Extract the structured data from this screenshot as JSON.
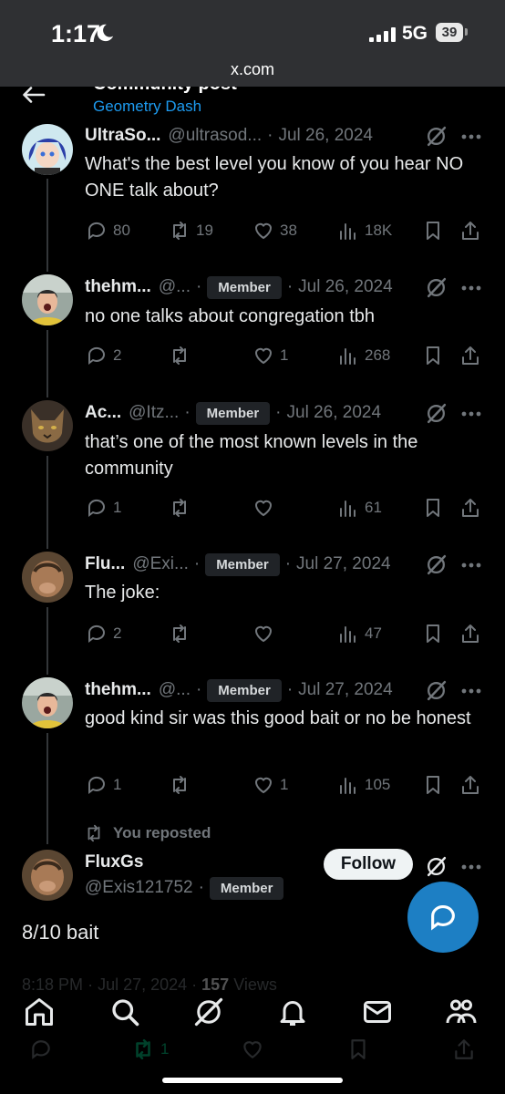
{
  "status_bar": {
    "time": "1:17",
    "network": "5G",
    "battery": "39"
  },
  "browser": {
    "url": "x.com"
  },
  "header": {
    "title": "Community post",
    "community": "Geometry Dash"
  },
  "posts": [
    {
      "name": "UltraSo...",
      "handle": "@ultrasod...",
      "badge": "",
      "date": "Jul 26, 2024",
      "text": "What's the best level you know of you hear NO ONE talk about?",
      "replies": "80",
      "reposts": "19",
      "likes": "38",
      "views": "18K"
    },
    {
      "name": "thehm...",
      "handle": "@...",
      "badge": "Member",
      "date": "Jul 26, 2024",
      "text": "no one talks about congregation tbh",
      "replies": "2",
      "reposts": "",
      "likes": "1",
      "views": "268"
    },
    {
      "name": "Ac...",
      "handle": "@Itz...",
      "badge": "Member",
      "date": "Jul 26, 2024",
      "text": "that’s one of the most known levels in the community",
      "replies": "1",
      "reposts": "",
      "likes": "",
      "views": "61"
    },
    {
      "name": "Flu...",
      "handle": "@Exi...",
      "badge": "Member",
      "date": "Jul 27, 2024",
      "text": "The joke:",
      "replies": "2",
      "reposts": "",
      "likes": "",
      "views": "47"
    },
    {
      "name": "thehm...",
      "handle": "@...",
      "badge": "Member",
      "date": "Jul 27, 2024",
      "text": "good kind sir was this good bait or no be honest",
      "replies": "1",
      "reposts": "",
      "likes": "1",
      "views": "105"
    }
  ],
  "repost_indicator": "You reposted",
  "main_post": {
    "name": "FluxGs",
    "handle": "@Exis121752",
    "badge": "Member",
    "follow_label": "Follow",
    "text": "8/10 bait",
    "time": "8:18 PM",
    "date": "Jul 27, 2024",
    "views_count": "157",
    "views_label": "Views",
    "reposts": "1"
  },
  "colors": {
    "accent": "#1d9bf0",
    "background": "#000000",
    "muted": "#71767b",
    "repost_active": "#00ba7c"
  },
  "tab_bar": [
    "home-icon",
    "search-icon",
    "grok-icon",
    "notifications-icon",
    "messages-icon",
    "communities-icon"
  ]
}
